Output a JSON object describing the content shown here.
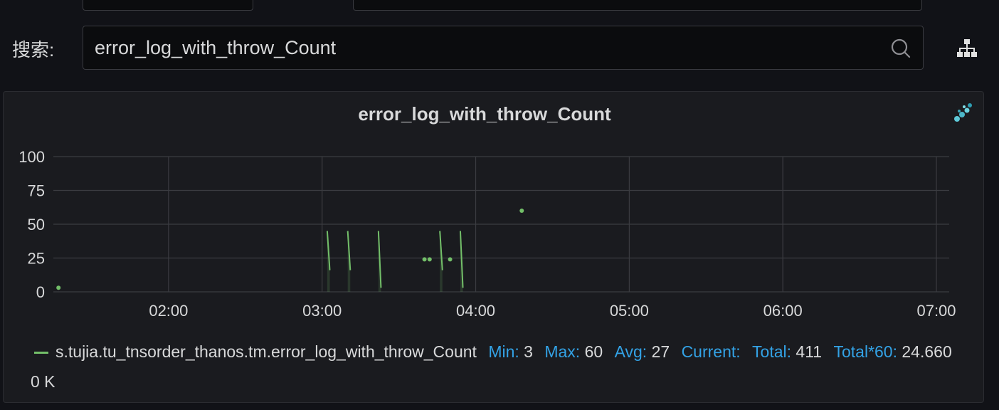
{
  "search": {
    "label": "搜索:",
    "value": "error_log_with_throw_Count"
  },
  "icons": {
    "search": "search-icon",
    "tree": "hierarchy-icon",
    "panel_logo": "panel-logo-icon"
  },
  "panel": {
    "title": "error_log_with_throw_Count"
  },
  "chart_data": {
    "type": "line",
    "title": "error_log_with_throw_Count",
    "x_ticks": [
      "02:00",
      "03:00",
      "04:00",
      "05:00",
      "06:00",
      "07:00"
    ],
    "y_ticks": [
      "100",
      "75",
      "50",
      "25",
      "0"
    ],
    "ylim": [
      0,
      100
    ],
    "xlim": [
      "01:15",
      "07:05"
    ],
    "grid": true,
    "series": [
      {
        "name": "s.tujia.tu_tnsorder_thanos.tm.error_log_with_throw_Count",
        "color": "#73bf69",
        "segments": [
          [
            [
              "03:02",
              45
            ],
            [
              "03:03",
              16
            ]
          ],
          [
            [
              "03:10",
              45
            ],
            [
              "03:11",
              16
            ]
          ],
          [
            [
              "03:22",
              45
            ],
            [
              "03:23",
              3
            ]
          ],
          [
            [
              "03:46",
              45
            ],
            [
              "03:47",
              16
            ]
          ],
          [
            [
              "03:54",
              45
            ],
            [
              "03:55",
              3
            ]
          ]
        ],
        "points": [
          [
            "01:17",
            3
          ],
          [
            "03:40",
            24
          ],
          [
            "03:42",
            24
          ],
          [
            "03:50",
            24
          ],
          [
            "04:18",
            60
          ]
        ]
      }
    ]
  },
  "legend": {
    "series_name": "s.tujia.tu_tnsorder_thanos.tm.error_log_with_throw_Count",
    "min_label": "Min:",
    "min": "3",
    "max_label": "Max:",
    "max": "60",
    "avg_label": "Avg:",
    "avg": "27",
    "current_label": "Current:",
    "current": "",
    "total_label": "Total:",
    "total": "411",
    "total60_label": "Total*60:",
    "total60": "24.660",
    "total60_unit": "0 K"
  },
  "colors": {
    "background": "#111217",
    "panel": "#1a1b1f",
    "series": "#73bf69",
    "legend_key": "#33a2e5"
  }
}
